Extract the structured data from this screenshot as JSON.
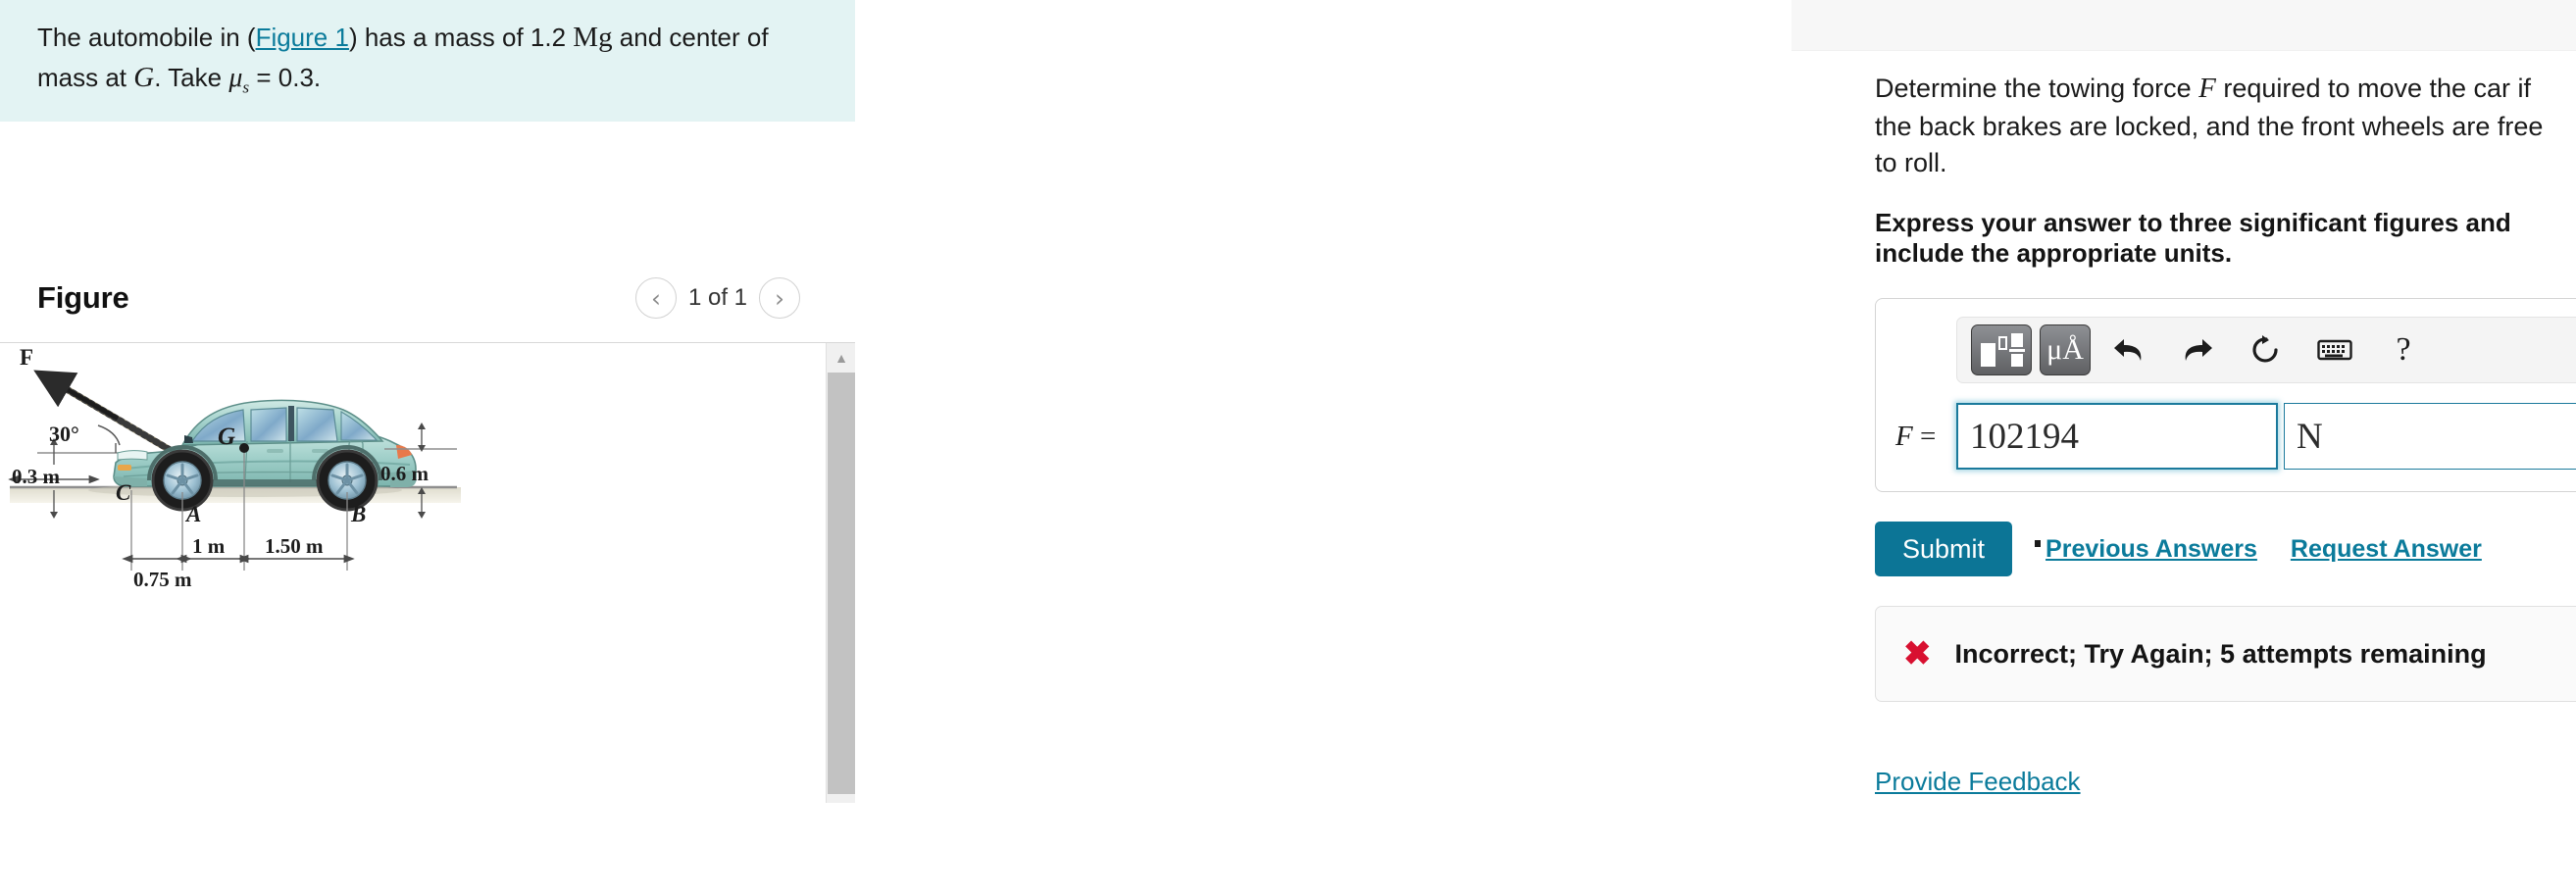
{
  "left": {
    "statement": {
      "part1": "The automobile in (",
      "figure_link": "Figure 1",
      "part2": ") has a mass of 1.2 ",
      "unit_mass": "Mg",
      "part3": " and center of mass at ",
      "point_g": "G",
      "part4": ". Take ",
      "mu_symbol": "μ",
      "mu_sub": "s",
      "part5": " = 0.3."
    },
    "figure": {
      "title": "Figure",
      "prev_icon": "chevron-left-icon",
      "next_icon": "chevron-right-icon",
      "counter": "1 of 1",
      "scroll_up_icon": "triangle-up-icon"
    },
    "diagram": {
      "force_label": "F",
      "angle_label": "30°",
      "height_c": "0.3 m",
      "point_c": "C",
      "point_a": "A",
      "point_b": "B",
      "point_g": "G",
      "dim_ca": "0.75 m",
      "dim_ag": "1 m",
      "dim_gb": "1.50 m",
      "height_rear": "0.6 m"
    }
  },
  "right": {
    "question": "Determine the towing force F required to move the car if the back brakes are locked, and the front wheels are free to roll.",
    "question_pre": "Determine the towing force ",
    "question_var": "F",
    "question_post": " required to move the car if the back brakes are locked, and the front wheels are free to roll.",
    "instruction": "Express your answer to three significant figures and include the appropriate units.",
    "toolbar": {
      "template_icon": "math-template-icon",
      "units_label": "μÅ",
      "units_icon": "micro-angstrom-icon",
      "undo_icon": "undo-arrow-icon",
      "redo_icon": "redo-arrow-icon",
      "reset_icon": "reset-circular-arrow-icon",
      "keyboard_icon": "keyboard-icon",
      "help_label": "?",
      "help_icon": "question-mark-icon"
    },
    "input": {
      "label": "F",
      "equals": "=",
      "value": "102194",
      "units_value": "N",
      "placeholder": "",
      "units_placeholder": ""
    },
    "actions": {
      "submit_label": "Submit",
      "previous_answers_label": "Previous Answers",
      "request_answer_label": "Request Answer"
    },
    "feedback": {
      "icon": "red-x-icon",
      "message": "Incorrect; Try Again; 5 attempts remaining"
    },
    "provide_feedback_label": "Provide Feedback"
  },
  "colors": {
    "statement_bg": "#e3f3f3",
    "accent_teal": "#0b7b9b",
    "submit_bg": "#0c7596",
    "input_border": "#1b7a9c",
    "error_red": "#d81030",
    "car_body": "#9ccfc9"
  }
}
